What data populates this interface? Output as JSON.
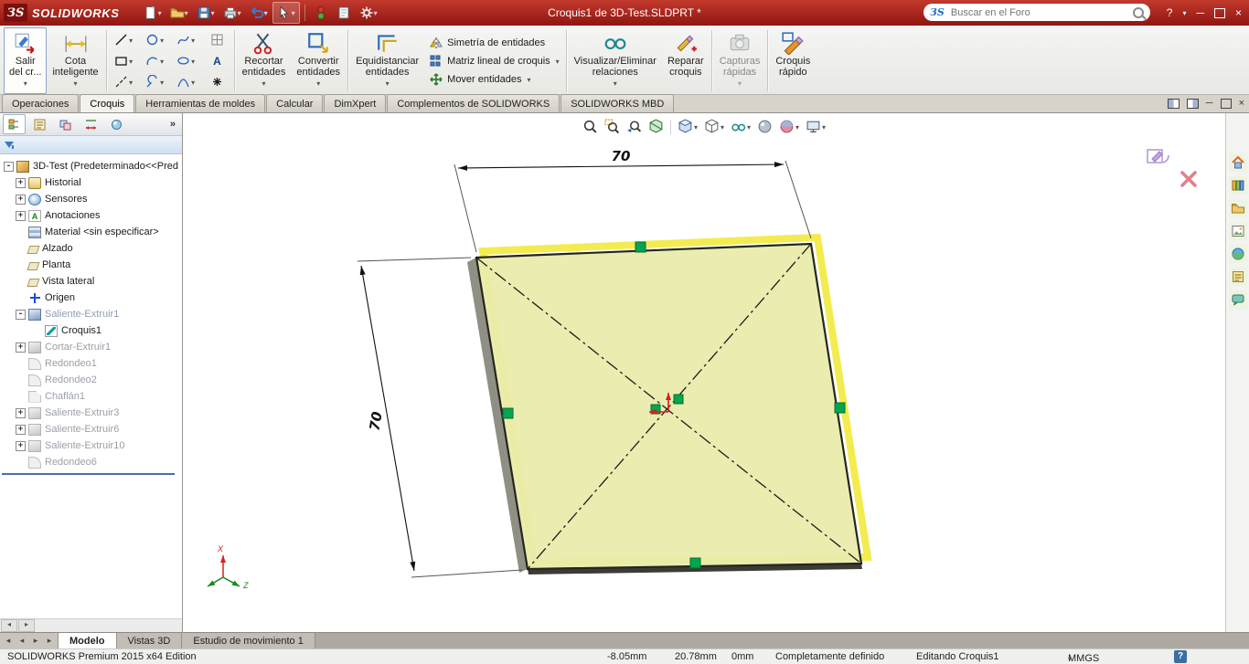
{
  "title_bar": {
    "app_name": "SOLIDWORKS",
    "logo_glyph": "ЗS",
    "document_title": "Croquis1 de 3D-Test.SLDPRT *",
    "search_placeholder": "Buscar en el Foro"
  },
  "glyphs": {
    "help": "?",
    "minimize": "─",
    "close": "×",
    "chevron_more": "»",
    "scroll_left": "◂",
    "scroll_right": "▸"
  },
  "ribbon": {
    "exit_sketch_l1": "Salir",
    "exit_sketch_l2": "del cr...",
    "smart_dim_l1": "Cota",
    "smart_dim_l2": "inteligente",
    "trim_l1": "Recortar",
    "trim_l2": "entidades",
    "convert_l1": "Convertir",
    "convert_l2": "entidades",
    "offset_l1": "Equidistanciar",
    "offset_l2": "entidades",
    "mirror": "Simetría de entidades",
    "linear_pattern": "Matriz lineal de croquis",
    "move": "Mover entidades",
    "relations_l1": "Visualizar/Eliminar",
    "relations_l2": "relaciones",
    "repair_l1": "Reparar",
    "repair_l2": "croquis",
    "snapshots_l1": "Capturas",
    "snapshots_l2": "rápidas",
    "rapid_l1": "Croquis",
    "rapid_l2": "rápido"
  },
  "command_tabs": [
    "Operaciones",
    "Croquis",
    "Herramientas de moldes",
    "Calcular",
    "DimXpert",
    "Complementos de SOLIDWORKS",
    "SOLIDWORKS MBD"
  ],
  "feature_tree": {
    "items": [
      {
        "label": "3D-Test  (Predeterminado<<Pred",
        "state": "normal",
        "exp": "-"
      },
      {
        "label": "Historial",
        "state": "normal",
        "exp": "+"
      },
      {
        "label": "Sensores",
        "state": "normal",
        "exp": "+"
      },
      {
        "label": "Anotaciones",
        "state": "normal",
        "exp": "+"
      },
      {
        "label": "Material <sin especificar>",
        "state": "normal",
        "exp": ""
      },
      {
        "label": "Alzado",
        "state": "normal",
        "exp": ""
      },
      {
        "label": "Planta",
        "state": "normal",
        "exp": ""
      },
      {
        "label": "Vista lateral",
        "state": "normal",
        "exp": ""
      },
      {
        "label": "Origen",
        "state": "normal",
        "exp": ""
      },
      {
        "label": "Saliente-Extruir1",
        "state": "dim",
        "exp": "-"
      },
      {
        "label": "Croquis1",
        "state": "active",
        "exp": ""
      },
      {
        "label": "Cortar-Extruir1",
        "state": "gray",
        "exp": "+"
      },
      {
        "label": "Redondeo1",
        "state": "gray",
        "exp": ""
      },
      {
        "label": "Redondeo2",
        "state": "gray",
        "exp": ""
      },
      {
        "label": "Chaflán1",
        "state": "gray",
        "exp": ""
      },
      {
        "label": "Saliente-Extruir3",
        "state": "gray",
        "exp": "+"
      },
      {
        "label": "Saliente-Extruir6",
        "state": "gray",
        "exp": "+"
      },
      {
        "label": "Saliente-Extruir10",
        "state": "gray",
        "exp": "+"
      },
      {
        "label": "Redondeo6",
        "state": "gray",
        "exp": ""
      }
    ]
  },
  "viewport": {
    "dim_width": "70",
    "dim_height": "70",
    "triad_x": "X",
    "triad_z": "Z"
  },
  "bottom_tabs": [
    "Modelo",
    "Vistas 3D",
    "Estudio de movimiento 1"
  ],
  "status_bar": {
    "edition": "SOLIDWORKS Premium 2015 x64 Edition",
    "coord_x": "-8.05mm",
    "coord_y": "20.78mm",
    "coord_z": "0mm",
    "definition": "Completamente definido",
    "mode": "Editando Croquis1",
    "units": "MMGS",
    "help_glyph": "?"
  }
}
